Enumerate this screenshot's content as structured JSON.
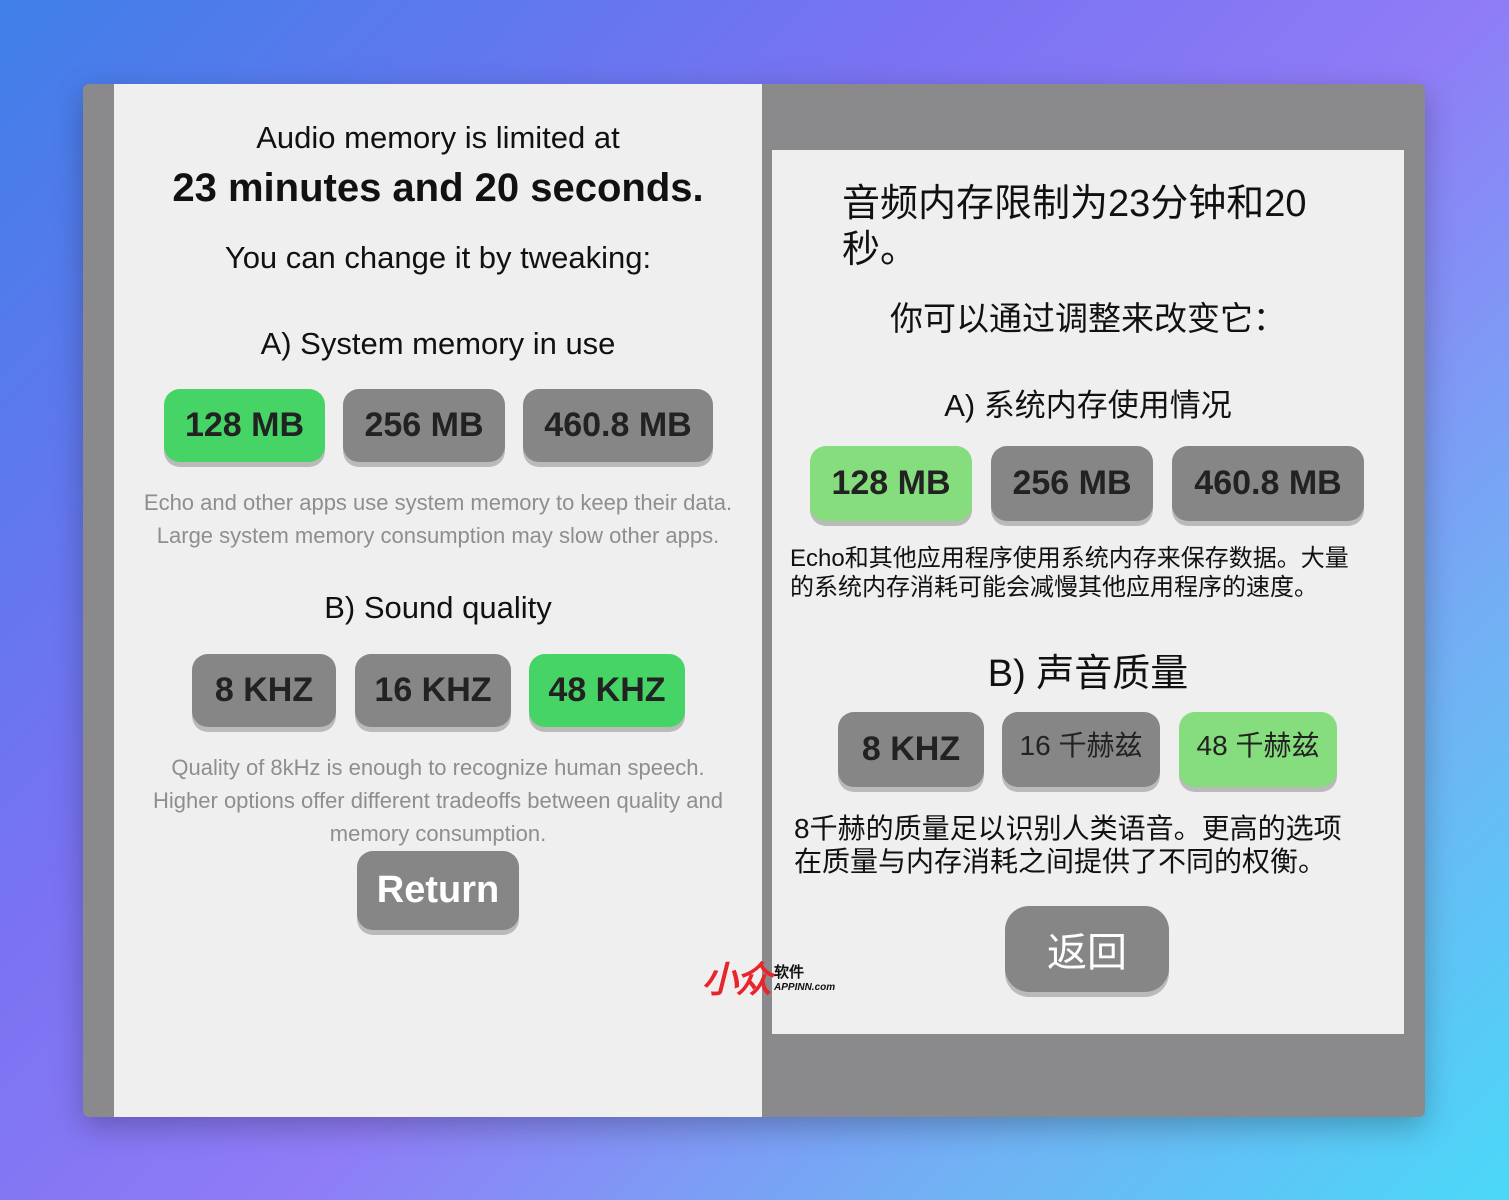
{
  "left": {
    "line1": "Audio memory is limited at",
    "line2": "23 minutes and 20 seconds.",
    "line3": "You can change it by tweaking:",
    "section_a": "A) System memory in use",
    "mem_options": [
      "128 MB",
      "256 MB",
      "460.8 MB"
    ],
    "mem_selected": "128 MB",
    "mem_desc_1": "Echo and other apps use system memory to keep their data.",
    "mem_desc_2": "Large system memory consumption may slow other apps.",
    "section_b": "B) Sound quality",
    "quality_options": [
      "8 KHZ",
      "16 KHZ",
      "48 KHZ"
    ],
    "quality_selected": "48 KHZ",
    "quality_desc_1": "Quality of 8kHz is enough to recognize human speech.",
    "quality_desc_2": "Higher options offer different tradeoffs between quality and",
    "quality_desc_3": "memory consumption.",
    "return_label": "Return"
  },
  "right": {
    "title_1": "音频内存限制为23分钟和20",
    "title_2": "秒。",
    "line3": "你可以通过调整来改变它：",
    "section_a": "A) 系统内存使用情况",
    "mem_options": [
      "128 MB",
      "256 MB",
      "460.8 MB"
    ],
    "mem_selected": "128 MB",
    "mem_desc_1": "Echo和其他应用程序使用系统内存来保存数据。大量",
    "mem_desc_2": "的系统内存消耗可能会减慢其他应用程序的速度。",
    "section_b": "B) 声音质量",
    "quality_options": [
      "8 KHZ",
      "16 千赫兹",
      "48 千赫兹"
    ],
    "quality_selected": "48 千赫兹",
    "quality_desc_1": "8千赫的质量足以识别人类语音。更高的选项",
    "quality_desc_2": "在质量与内存消耗之间提供了不同的权衡。",
    "return_label": "返回"
  },
  "watermark": {
    "logo": "小众",
    "cn": "软件",
    "site": "APPINN.com"
  },
  "colors": {
    "selected_green": "#45d465",
    "pale_green": "#86dd7e",
    "button_gray": "#868686",
    "panel_bg": "#efefef",
    "frame_gray": "#8a8a8c",
    "watermark_red": "#e8242c"
  }
}
